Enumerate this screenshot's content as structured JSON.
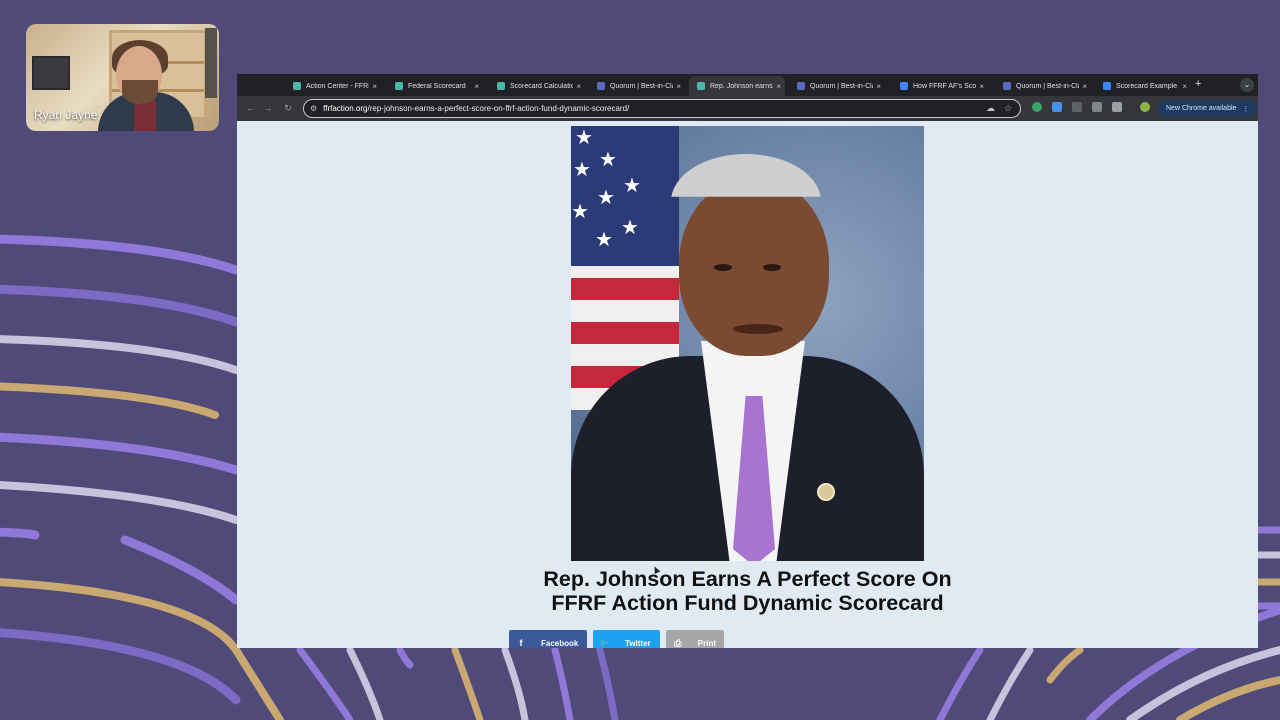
{
  "participant": {
    "name": "Ryan Jayne"
  },
  "browser": {
    "tabs": [
      {
        "label": "Action Center - FFRF",
        "favicon_color": "#4db6ac",
        "active": false
      },
      {
        "label": "Federal Scorecard",
        "favicon_color": "#4db6ac",
        "active": false
      },
      {
        "label": "Scorecard Calculations",
        "favicon_color": "#4db6ac",
        "active": false
      },
      {
        "label": "Quorum | Best-in-Class",
        "favicon_color": "#5c6bc0",
        "active": false
      },
      {
        "label": "Rep. Johnson earns",
        "favicon_color": "#4db6ac",
        "active": true
      },
      {
        "label": "Quorum | Best-in-Class",
        "favicon_color": "#5c6bc0",
        "active": false
      },
      {
        "label": "How FFRF AF's Scorecard",
        "favicon_color": "#4285f4",
        "active": false
      },
      {
        "label": "Quorum | Best-in-Class",
        "favicon_color": "#5c6bc0",
        "active": false
      },
      {
        "label": "Scorecard Example",
        "favicon_color": "#4285f4",
        "active": false
      }
    ],
    "url_domain": "ffrfaction.org",
    "url_path": "/rep-johnson-earns-a-perfect-score-on-ffrf-action-fund-dynamic-scorecard/",
    "update_label": "New Chrome available"
  },
  "article": {
    "title_line1": "Rep. Johnson Earns A Perfect Score On",
    "title_line2": "FFRF Action Fund Dynamic Scorecard",
    "share": [
      {
        "label": "Facebook",
        "icon": "facebook-icon",
        "color": "#3b5998"
      },
      {
        "label": "Twitter",
        "icon": "twitter-icon",
        "color": "#1da1f2"
      },
      {
        "label": "Print",
        "icon": "print-icon",
        "color": "#a6a6a6"
      }
    ]
  }
}
